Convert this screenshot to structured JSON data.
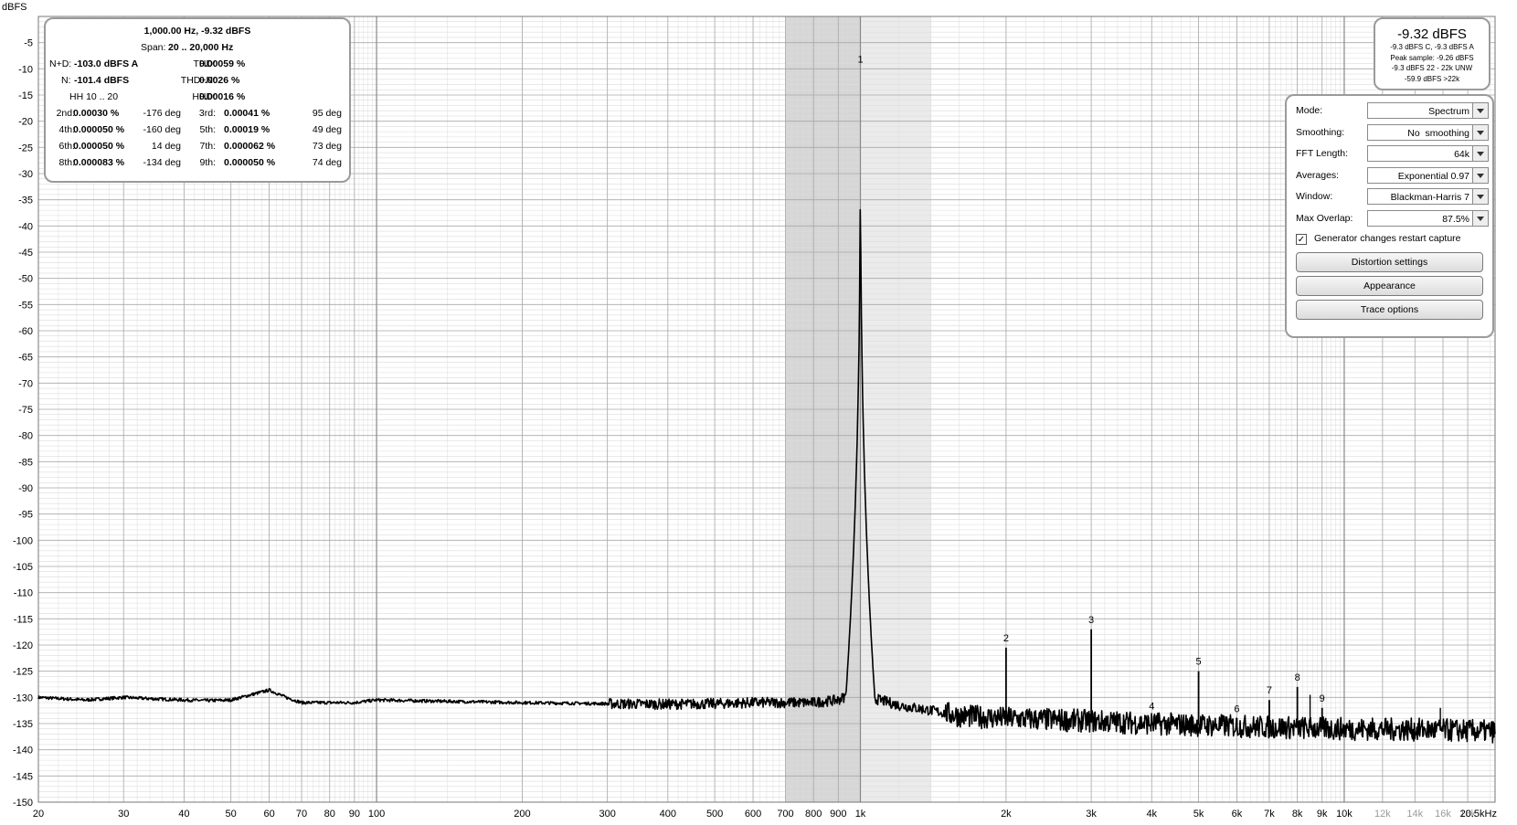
{
  "measurements": {
    "header": "1,000.00 Hz, -9.32 dBFS",
    "span_label": "Span:",
    "span_value": "20 .. 20,000 Hz",
    "nd_label": "N+D:",
    "nd_value": "-103.0 dBFS A",
    "thd_label": "THD:",
    "thd_value": "0.00059 %",
    "n_label": "N:",
    "n_value": "-101.4 dBFS",
    "thdn_label": "THD+N:",
    "thdn_value": "0.0026 %",
    "hh_label": "HH 10 .. 20",
    "hhd_label": "HHD:",
    "hhd_value": "0.00016 %",
    "harmonics": [
      {
        "label": "2nd:",
        "value": "0.00030 %",
        "phase": "-176 deg"
      },
      {
        "label": "3rd:",
        "value": "0.00041 %",
        "phase": "95 deg"
      },
      {
        "label": "4th:",
        "value": "0.000050 %",
        "phase": "-160 deg"
      },
      {
        "label": "5th:",
        "value": "0.00019 %",
        "phase": "49 deg"
      },
      {
        "label": "6th:",
        "value": "0.000050 %",
        "phase": "14 deg"
      },
      {
        "label": "7th:",
        "value": "0.000062 %",
        "phase": "73 deg"
      },
      {
        "label": "8th:",
        "value": "0.000083 %",
        "phase": "-134 deg"
      },
      {
        "label": "9th:",
        "value": "0.000050 %",
        "phase": "74 deg"
      }
    ]
  },
  "level": {
    "main": "-9.32 dBFS",
    "lines": [
      "-9.3 dBFS C, -9.3 dBFS A",
      "Peak sample: -9.26 dBFS",
      "-9.3 dBFS 22 - 22k UNW",
      "-59.9 dBFS >22k"
    ]
  },
  "controls": {
    "mode": {
      "label": "Mode:",
      "value": "Spectrum"
    },
    "smoothing": {
      "label": "Smoothing:",
      "value": "No  smoothing"
    },
    "fft": {
      "label": "FFT Length:",
      "value": "64k"
    },
    "averages": {
      "label": "Averages:",
      "value": "Exponential 0.97"
    },
    "window": {
      "label": "Window:",
      "value": "Blackman-Harris 7"
    },
    "overlap": {
      "label": "Max Overlap:",
      "value": "87.5%"
    },
    "checkbox": {
      "label": "Generator changes restart capture",
      "checked": true,
      "mark": "✓"
    },
    "buttons": [
      "Distortion settings",
      "Appearance",
      "Trace options"
    ]
  },
  "colors": {
    "trace": "#000000",
    "major_grid": "#a8a8a8",
    "minor_grid": "#dcdcdc",
    "band_dark": "#d6d6d6",
    "band_light": "#ebebeb",
    "faded_tick": "#9a9a9a"
  },
  "chart_data": {
    "type": "line",
    "ylabel": "dBFS",
    "xscale": "log",
    "xlim": [
      20,
      20500
    ],
    "ylim": [
      -150,
      0
    ],
    "grid": true,
    "y_ticks": [
      -5,
      -10,
      -15,
      -20,
      -25,
      -30,
      -35,
      -40,
      -45,
      -50,
      -55,
      -60,
      -65,
      -70,
      -75,
      -80,
      -85,
      -90,
      -95,
      -100,
      -105,
      -110,
      -115,
      -120,
      -125,
      -130,
      -135,
      -140,
      -145,
      -150
    ],
    "x_ticks": [
      {
        "v": 20,
        "t": "20"
      },
      {
        "v": 30,
        "t": "30"
      },
      {
        "v": 40,
        "t": "40"
      },
      {
        "v": 50,
        "t": "50"
      },
      {
        "v": 60,
        "t": "60"
      },
      {
        "v": 70,
        "t": "70"
      },
      {
        "v": 80,
        "t": "80"
      },
      {
        "v": 90,
        "t": "90"
      },
      {
        "v": 100,
        "t": "100"
      },
      {
        "v": 200,
        "t": "200"
      },
      {
        "v": 300,
        "t": "300"
      },
      {
        "v": 400,
        "t": "400"
      },
      {
        "v": 500,
        "t": "500"
      },
      {
        "v": 600,
        "t": "600"
      },
      {
        "v": 700,
        "t": "700"
      },
      {
        "v": 800,
        "t": "800"
      },
      {
        "v": 900,
        "t": "900"
      },
      {
        "v": 1000,
        "t": "1k"
      },
      {
        "v": 2000,
        "t": "2k"
      },
      {
        "v": 3000,
        "t": "3k"
      },
      {
        "v": 4000,
        "t": "4k"
      },
      {
        "v": 5000,
        "t": "5k"
      },
      {
        "v": 6000,
        "t": "6k"
      },
      {
        "v": 7000,
        "t": "7k"
      },
      {
        "v": 8000,
        "t": "8k"
      },
      {
        "v": 9000,
        "t": "9k"
      },
      {
        "v": 10000,
        "t": "10k"
      },
      {
        "v": 12000,
        "t": "12k",
        "faded": true
      },
      {
        "v": 14000,
        "t": "14k",
        "faded": true
      },
      {
        "v": 16000,
        "t": "16k",
        "faded": true
      },
      {
        "v": 18000,
        "t": "18k",
        "faded": true
      },
      {
        "v": 20500,
        "t": "20.5kHz"
      }
    ],
    "shaded_bands": [
      {
        "from": 700,
        "to": 1000,
        "shade": "dark"
      },
      {
        "from": 1000,
        "to": 1400,
        "shade": "light"
      }
    ],
    "noise_floor": [
      [
        20,
        -130.0
      ],
      [
        25,
        -130.5
      ],
      [
        30,
        -130.0
      ],
      [
        35,
        -130.3
      ],
      [
        40,
        -130.5
      ],
      [
        45,
        -130.6
      ],
      [
        50,
        -130.5
      ],
      [
        55,
        -129.5
      ],
      [
        60,
        -128.6
      ],
      [
        65,
        -130.0
      ],
      [
        70,
        -131.0
      ],
      [
        80,
        -131.0
      ],
      [
        90,
        -131.0
      ],
      [
        100,
        -130.5
      ],
      [
        150,
        -130.8
      ],
      [
        200,
        -131.0
      ],
      [
        300,
        -131.2
      ],
      [
        400,
        -131.3
      ],
      [
        500,
        -131.2
      ],
      [
        600,
        -131.0
      ],
      [
        700,
        -131.0
      ],
      [
        800,
        -131.0
      ],
      [
        900,
        -130.5
      ],
      [
        950,
        -129.5
      ],
      [
        1100,
        -130.5
      ],
      [
        1200,
        -131.5
      ],
      [
        1400,
        -132.5
      ],
      [
        1600,
        -133.5
      ],
      [
        2000,
        -134.0
      ],
      [
        3000,
        -134.5
      ],
      [
        4000,
        -135.0
      ],
      [
        6000,
        -135.5
      ],
      [
        8000,
        -135.8
      ],
      [
        10000,
        -136.0
      ],
      [
        15000,
        -136.2
      ],
      [
        20500,
        -136.5
      ]
    ],
    "peaks": [
      {
        "n": "1",
        "f": 1000,
        "level": -10.0
      },
      {
        "n": "2",
        "f": 2000,
        "level": -120.5
      },
      {
        "n": "3",
        "f": 3000,
        "level": -117.0
      },
      {
        "n": "4",
        "f": 4000,
        "level": -133.5
      },
      {
        "n": "5",
        "f": 5000,
        "level": -125.0
      },
      {
        "n": "6",
        "f": 6000,
        "level": -134.0
      },
      {
        "n": "7",
        "f": 7000,
        "level": -130.5
      },
      {
        "n": "8",
        "f": 8000,
        "level": -128.0
      },
      {
        "n": "9",
        "f": 9000,
        "level": -132.0
      }
    ],
    "unlabeled_spurs": [
      {
        "f": 8500,
        "level": -129.5
      },
      {
        "f": 15800,
        "level": -132.0
      }
    ]
  }
}
